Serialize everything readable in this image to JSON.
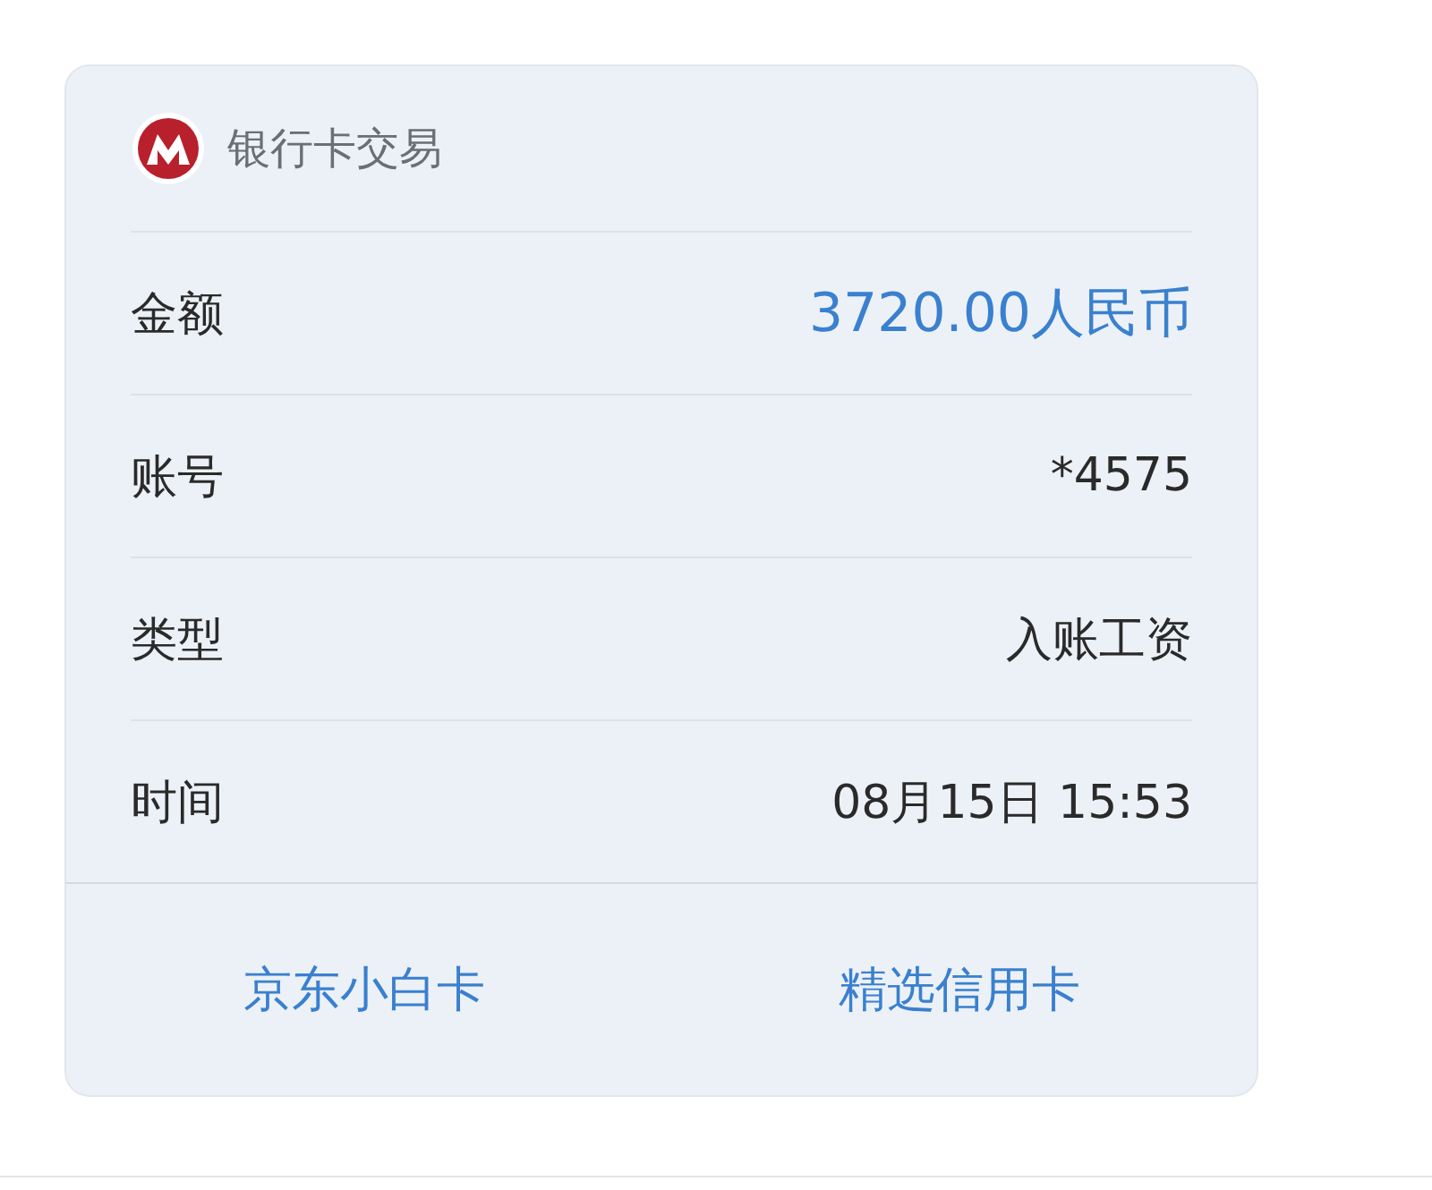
{
  "header": {
    "title": "银行卡交易"
  },
  "rows": [
    {
      "label": "金额",
      "value": "3720.00人民币",
      "emphasized": true
    },
    {
      "label": "账号",
      "value": "*4575",
      "emphasized": false
    },
    {
      "label": "类型",
      "value": "入账工资",
      "emphasized": false
    },
    {
      "label": "时间",
      "value": "08月15日 15:53",
      "emphasized": false
    }
  ],
  "actions": [
    "京东小白卡",
    "精选信用卡"
  ]
}
